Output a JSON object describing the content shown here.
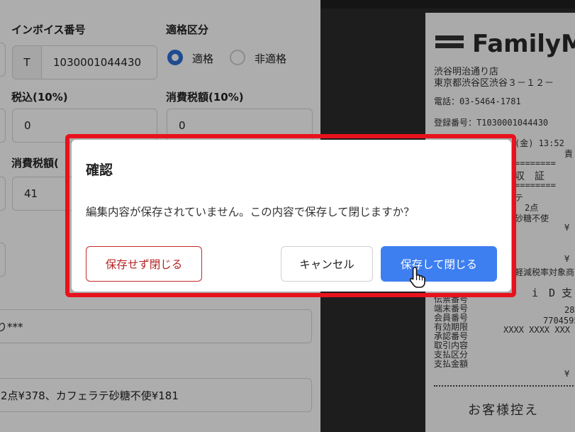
{
  "form": {
    "invoice_number_label": "インボイス番号",
    "invoice_prefix": "T",
    "invoice_number_value": "1030001044430",
    "eligibility_label": "適格区分",
    "eligibility_options": [
      "適格",
      "非適格"
    ],
    "eligibility_selected": "適格",
    "tax_incl_10_label": "税込(10%)",
    "tax_incl_10_value": "0",
    "consumption_tax_10_label": "消費税額(10%)",
    "consumption_tax_10_value": "0",
    "consumption_tax_8_label_partial": "消費税額(",
    "consumption_tax_8_value": "41",
    "masked_value_partial": "り***",
    "memo_partial": "2点¥378、カフェラテ砂糖不使¥181"
  },
  "receipt": {
    "store_brand": "FamilyM",
    "store_branch": "渋谷明治通り店",
    "store_address": "東京都渋谷区渋谷３－１２－",
    "phone": "電話：03-5464-1781",
    "registration": "登録番号：T1030001044430",
    "date_fragment": "(金) 13:52",
    "line_a": "責",
    "separator": "========",
    "receipt_heading": "収　証",
    "item_fragment": "テ",
    "qty_fragment": "2点",
    "item_fragment_2": "砂糖不使",
    "yen_fragment": "¥",
    "reduced_tax_note": "軽減税率対象商品で",
    "payment_fragment": "i　D 支",
    "rows": [
      "伝票番号",
      "端末番号",
      "会員番号",
      "有効期限",
      "承認番号",
      "取引内容",
      "支払区分",
      "支払金額"
    ],
    "slip_no_fragment": "28",
    "terminal_fragment": "7704595",
    "member_fragment": "XXXX XXXX XXX",
    "amount_fragment": "¥",
    "customer_copy": "お客様控え"
  },
  "dialog": {
    "title": "確認",
    "message": "編集内容が保存されていません。この内容で保存して閉じますか？",
    "discard_label": "保存せず閉じる",
    "cancel_label": "キャンセル",
    "save_label": "保存して閉じる"
  },
  "colors": {
    "primary": "#3d7ff0",
    "danger": "#c42a2a",
    "highlight": "#e8121c",
    "overlay": "rgba(0,0,0,0.32)"
  }
}
